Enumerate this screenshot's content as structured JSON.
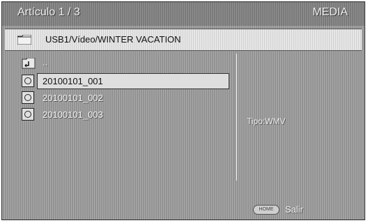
{
  "header": {
    "title": "Artículo 1 / 3",
    "mode": "MEDIA"
  },
  "path": {
    "icon": "folder-icon",
    "text": "USB1/Vídeo/WINTER VACATION"
  },
  "list": {
    "parent": {
      "icon": "parent-folder-icon",
      "label": ".."
    },
    "items": [
      {
        "label": "20100101_001",
        "icon": "video-file-icon",
        "selected": true
      },
      {
        "label": "20100101_002",
        "icon": "video-file-icon",
        "selected": false
      },
      {
        "label": "20100101_003",
        "icon": "video-file-icon",
        "selected": false
      }
    ]
  },
  "info": {
    "type_label": "Tipo:WMV"
  },
  "footer": {
    "home_button": "HOME",
    "exit_label": "Salir"
  }
}
